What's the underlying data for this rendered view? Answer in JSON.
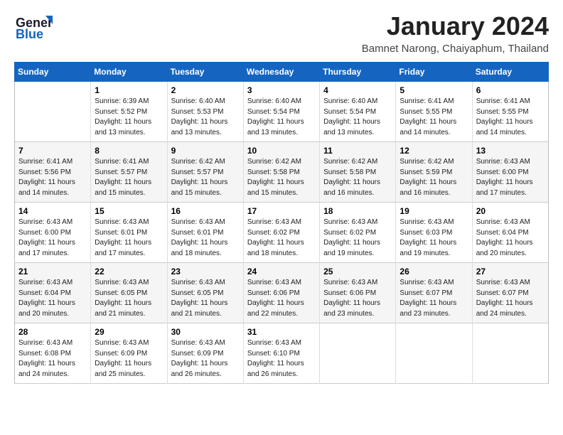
{
  "header": {
    "logo_line1": "General",
    "logo_line2": "Blue",
    "month": "January 2024",
    "location": "Bamnet Narong, Chaiyaphum, Thailand"
  },
  "weekdays": [
    "Sunday",
    "Monday",
    "Tuesday",
    "Wednesday",
    "Thursday",
    "Friday",
    "Saturday"
  ],
  "weeks": [
    [
      {
        "day": "",
        "text": ""
      },
      {
        "day": "1",
        "text": "Sunrise: 6:39 AM\nSunset: 5:52 PM\nDaylight: 11 hours\nand 13 minutes."
      },
      {
        "day": "2",
        "text": "Sunrise: 6:40 AM\nSunset: 5:53 PM\nDaylight: 11 hours\nand 13 minutes."
      },
      {
        "day": "3",
        "text": "Sunrise: 6:40 AM\nSunset: 5:54 PM\nDaylight: 11 hours\nand 13 minutes."
      },
      {
        "day": "4",
        "text": "Sunrise: 6:40 AM\nSunset: 5:54 PM\nDaylight: 11 hours\nand 13 minutes."
      },
      {
        "day": "5",
        "text": "Sunrise: 6:41 AM\nSunset: 5:55 PM\nDaylight: 11 hours\nand 14 minutes."
      },
      {
        "day": "6",
        "text": "Sunrise: 6:41 AM\nSunset: 5:55 PM\nDaylight: 11 hours\nand 14 minutes."
      }
    ],
    [
      {
        "day": "7",
        "text": "Sunrise: 6:41 AM\nSunset: 5:56 PM\nDaylight: 11 hours\nand 14 minutes."
      },
      {
        "day": "8",
        "text": "Sunrise: 6:41 AM\nSunset: 5:57 PM\nDaylight: 11 hours\nand 15 minutes."
      },
      {
        "day": "9",
        "text": "Sunrise: 6:42 AM\nSunset: 5:57 PM\nDaylight: 11 hours\nand 15 minutes."
      },
      {
        "day": "10",
        "text": "Sunrise: 6:42 AM\nSunset: 5:58 PM\nDaylight: 11 hours\nand 15 minutes."
      },
      {
        "day": "11",
        "text": "Sunrise: 6:42 AM\nSunset: 5:58 PM\nDaylight: 11 hours\nand 16 minutes."
      },
      {
        "day": "12",
        "text": "Sunrise: 6:42 AM\nSunset: 5:59 PM\nDaylight: 11 hours\nand 16 minutes."
      },
      {
        "day": "13",
        "text": "Sunrise: 6:43 AM\nSunset: 6:00 PM\nDaylight: 11 hours\nand 17 minutes."
      }
    ],
    [
      {
        "day": "14",
        "text": "Sunrise: 6:43 AM\nSunset: 6:00 PM\nDaylight: 11 hours\nand 17 minutes."
      },
      {
        "day": "15",
        "text": "Sunrise: 6:43 AM\nSunset: 6:01 PM\nDaylight: 11 hours\nand 17 minutes."
      },
      {
        "day": "16",
        "text": "Sunrise: 6:43 AM\nSunset: 6:01 PM\nDaylight: 11 hours\nand 18 minutes."
      },
      {
        "day": "17",
        "text": "Sunrise: 6:43 AM\nSunset: 6:02 PM\nDaylight: 11 hours\nand 18 minutes."
      },
      {
        "day": "18",
        "text": "Sunrise: 6:43 AM\nSunset: 6:02 PM\nDaylight: 11 hours\nand 19 minutes."
      },
      {
        "day": "19",
        "text": "Sunrise: 6:43 AM\nSunset: 6:03 PM\nDaylight: 11 hours\nand 19 minutes."
      },
      {
        "day": "20",
        "text": "Sunrise: 6:43 AM\nSunset: 6:04 PM\nDaylight: 11 hours\nand 20 minutes."
      }
    ],
    [
      {
        "day": "21",
        "text": "Sunrise: 6:43 AM\nSunset: 6:04 PM\nDaylight: 11 hours\nand 20 minutes."
      },
      {
        "day": "22",
        "text": "Sunrise: 6:43 AM\nSunset: 6:05 PM\nDaylight: 11 hours\nand 21 minutes."
      },
      {
        "day": "23",
        "text": "Sunrise: 6:43 AM\nSunset: 6:05 PM\nDaylight: 11 hours\nand 21 minutes."
      },
      {
        "day": "24",
        "text": "Sunrise: 6:43 AM\nSunset: 6:06 PM\nDaylight: 11 hours\nand 22 minutes."
      },
      {
        "day": "25",
        "text": "Sunrise: 6:43 AM\nSunset: 6:06 PM\nDaylight: 11 hours\nand 23 minutes."
      },
      {
        "day": "26",
        "text": "Sunrise: 6:43 AM\nSunset: 6:07 PM\nDaylight: 11 hours\nand 23 minutes."
      },
      {
        "day": "27",
        "text": "Sunrise: 6:43 AM\nSunset: 6:07 PM\nDaylight: 11 hours\nand 24 minutes."
      }
    ],
    [
      {
        "day": "28",
        "text": "Sunrise: 6:43 AM\nSunset: 6:08 PM\nDaylight: 11 hours\nand 24 minutes."
      },
      {
        "day": "29",
        "text": "Sunrise: 6:43 AM\nSunset: 6:09 PM\nDaylight: 11 hours\nand 25 minutes."
      },
      {
        "day": "30",
        "text": "Sunrise: 6:43 AM\nSunset: 6:09 PM\nDaylight: 11 hours\nand 26 minutes."
      },
      {
        "day": "31",
        "text": "Sunrise: 6:43 AM\nSunset: 6:10 PM\nDaylight: 11 hours\nand 26 minutes."
      },
      {
        "day": "",
        "text": ""
      },
      {
        "day": "",
        "text": ""
      },
      {
        "day": "",
        "text": ""
      }
    ]
  ]
}
